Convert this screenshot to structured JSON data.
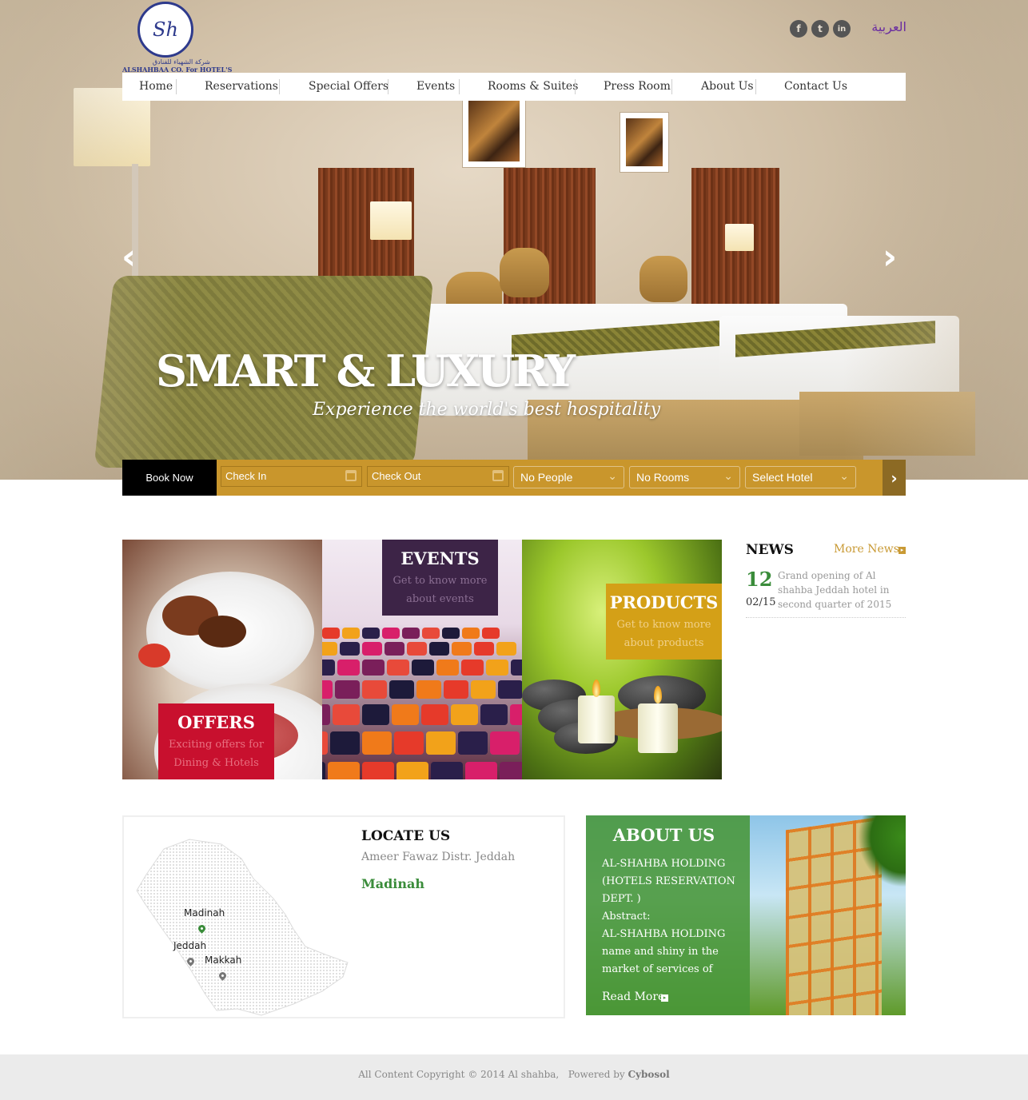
{
  "header": {
    "logo": {
      "monogram": "Sh",
      "caption": "ALSHAHBAA CO. For HOTEL'S",
      "caption_ar": "شركة الشهباء للفنادق"
    },
    "social": [
      {
        "icon": "facebook-icon",
        "glyph": "f"
      },
      {
        "icon": "twitter-icon",
        "glyph": "t"
      },
      {
        "icon": "linkedin-icon",
        "glyph": "in"
      }
    ],
    "language": "العربية"
  },
  "nav": {
    "items": [
      {
        "label": "Home"
      },
      {
        "label": "Reservations"
      },
      {
        "label": "Special Offers"
      },
      {
        "label": "Events"
      },
      {
        "label": "Rooms & Suites"
      },
      {
        "label": "Press Room"
      },
      {
        "label": "About Us"
      },
      {
        "label": "Contact Us"
      }
    ]
  },
  "slider": {
    "title": "SMART & LUXURY",
    "subtitle": "Experience the world's best hospitality",
    "prev_glyph": "‹",
    "next_glyph": "›"
  },
  "booking": {
    "label": "Book Now",
    "check_in": "Check In",
    "check_out": "Check Out",
    "people": "No People",
    "rooms": "No Rooms",
    "hotel": "Select Hotel",
    "go_glyph": "›"
  },
  "tiles": {
    "offers": {
      "title": "OFFERS",
      "desc_1": "Exciting offers for",
      "desc_2": "Dining & Hotels",
      "color": "#c8102e"
    },
    "events": {
      "title": "EVENTS",
      "desc_1": "Get to know more",
      "desc_2": "about events",
      "color": "#3d2447"
    },
    "products": {
      "title": "PRODUCTS",
      "desc_1": "Get to know more",
      "desc_2": "about products",
      "color": "#d4a017"
    }
  },
  "news": {
    "title": "NEWS",
    "more": "More News",
    "items": [
      {
        "day": "12",
        "date": "02/15",
        "text": "Grand opening of Al shahba Jeddah hotel in second quarter of 2015"
      }
    ]
  },
  "locate": {
    "title": "LOCATE US",
    "address": "Ameer Fawaz Distr. Jeddah",
    "city": "Madinah",
    "map_cities": [
      "Madinah",
      "Jeddah",
      "Makkah"
    ]
  },
  "about": {
    "title": "ABOUT US",
    "lines": [
      "AL-SHAHBA HOLDING",
      "(HOTELS RESERVATION",
      "DEPT. )",
      "Abstract:",
      "AL-SHAHBA HOLDING",
      "name and shiny in the",
      "market of services of"
    ],
    "read_more": "Read More"
  },
  "footer": {
    "copyright": "All Content Copyright © 2014 Al shahba,",
    "powered_by": "Powered by",
    "company": "Cybosol"
  },
  "colors": {
    "booking_gold": "#c9962c",
    "news_green": "#3a8c3a",
    "accent_gold": "#c99a35",
    "about_green": "#489638"
  }
}
